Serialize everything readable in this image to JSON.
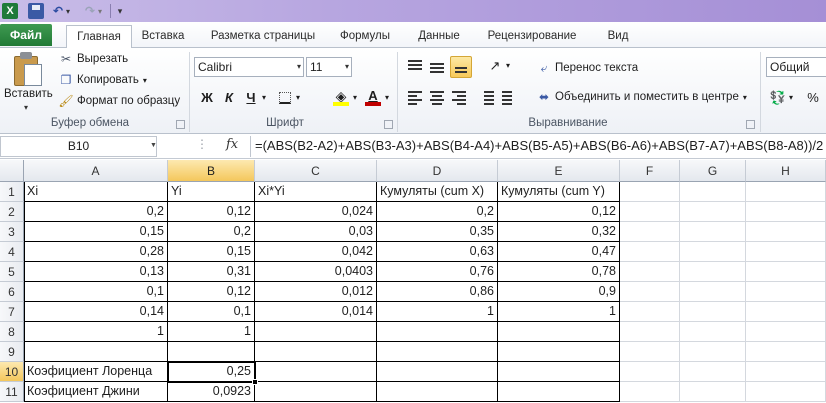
{
  "qa": {
    "logo": "X"
  },
  "tabs": [
    {
      "label": "Файл"
    },
    {
      "label": "Главная"
    },
    {
      "label": "Вставка"
    },
    {
      "label": "Разметка страницы"
    },
    {
      "label": "Формулы"
    },
    {
      "label": "Данные"
    },
    {
      "label": "Рецензирование"
    },
    {
      "label": "Вид"
    }
  ],
  "clipboard": {
    "paste": "Вставить",
    "cut": "Вырезать",
    "copy": "Копировать",
    "format_painter": "Формат по образцу",
    "label": "Буфер обмена"
  },
  "font": {
    "name": "Calibri",
    "size": "11",
    "bold": "Ж",
    "italic": "К",
    "underline": "Ч",
    "label": "Шрифт",
    "fill_color": "#ffff00",
    "font_color": "#c00000"
  },
  "alignment": {
    "wrap": "Перенос текста",
    "merge": "Объединить и поместить в центре",
    "label": "Выравнивание"
  },
  "number": {
    "format": "Общий",
    "percent": "%"
  },
  "formula_bar": {
    "name_box": "B10",
    "fx": "fx",
    "formula": "=(ABS(B2-A2)+ABS(B3-A3)+ABS(B4-A4)+ABS(B5-A5)+ABS(B6-A6)+ABS(B7-A7)+ABS(B8-A8))/2"
  },
  "sheet": {
    "columns": [
      "A",
      "B",
      "C",
      "D",
      "E",
      "F",
      "G",
      "H"
    ],
    "rows": [
      {
        "n": "1",
        "cells": [
          "Xi",
          "Yi",
          "Xi*Yi",
          "Кумуляты (cum X)",
          "Кумуляты (cum Y)"
        ]
      },
      {
        "n": "2",
        "cells": [
          "0,2",
          "0,12",
          "0,024",
          "0,2",
          "0,12"
        ]
      },
      {
        "n": "3",
        "cells": [
          "0,15",
          "0,2",
          "0,03",
          "0,35",
          "0,32"
        ]
      },
      {
        "n": "4",
        "cells": [
          "0,28",
          "0,15",
          "0,042",
          "0,63",
          "0,47"
        ]
      },
      {
        "n": "5",
        "cells": [
          "0,13",
          "0,31",
          "0,0403",
          "0,76",
          "0,78"
        ]
      },
      {
        "n": "6",
        "cells": [
          "0,1",
          "0,12",
          "0,012",
          "0,86",
          "0,9"
        ]
      },
      {
        "n": "7",
        "cells": [
          "0,14",
          "0,1",
          "0,014",
          "1",
          "1"
        ]
      },
      {
        "n": "8",
        "cells": [
          "1",
          "1",
          "",
          "",
          ""
        ]
      },
      {
        "n": "9",
        "cells": [
          "",
          "",
          "",
          "",
          ""
        ]
      },
      {
        "n": "10",
        "cells": [
          "Коэфициент Лоренца",
          "0,25",
          "",
          "",
          ""
        ]
      },
      {
        "n": "11",
        "cells": [
          "Коэфициент Джини",
          "0,0923",
          "",
          "",
          ""
        ]
      }
    ]
  }
}
